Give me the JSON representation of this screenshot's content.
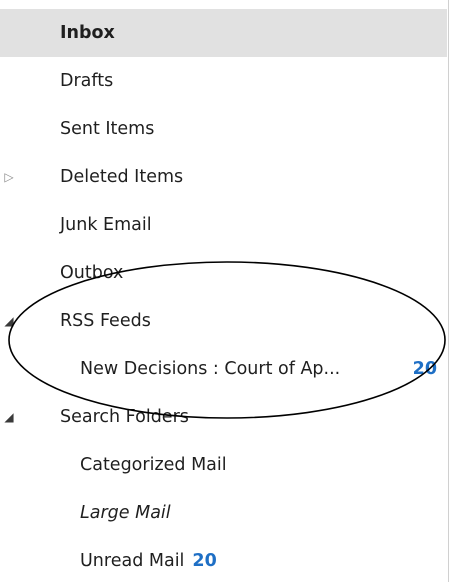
{
  "folders": [
    {
      "label": "Inbox",
      "count": "",
      "selected": true
    },
    {
      "label": "Drafts",
      "count": ""
    },
    {
      "label": "Sent Items",
      "count": ""
    },
    {
      "label": "Deleted Items",
      "count": "",
      "expander": "▷"
    },
    {
      "label": "Junk Email",
      "count": ""
    },
    {
      "label": "Outbox",
      "count": ""
    },
    {
      "label": "RSS Feeds",
      "count": "",
      "expander": "◢"
    },
    {
      "label": "New Decisions : Court of Ap...",
      "count": "20"
    },
    {
      "label": "Search Folders",
      "count": "",
      "expander": "◢"
    },
    {
      "label": "Categorized Mail",
      "count": ""
    },
    {
      "label": "Large Mail",
      "count": ""
    },
    {
      "label": "Unread Mail",
      "count": "20"
    }
  ]
}
